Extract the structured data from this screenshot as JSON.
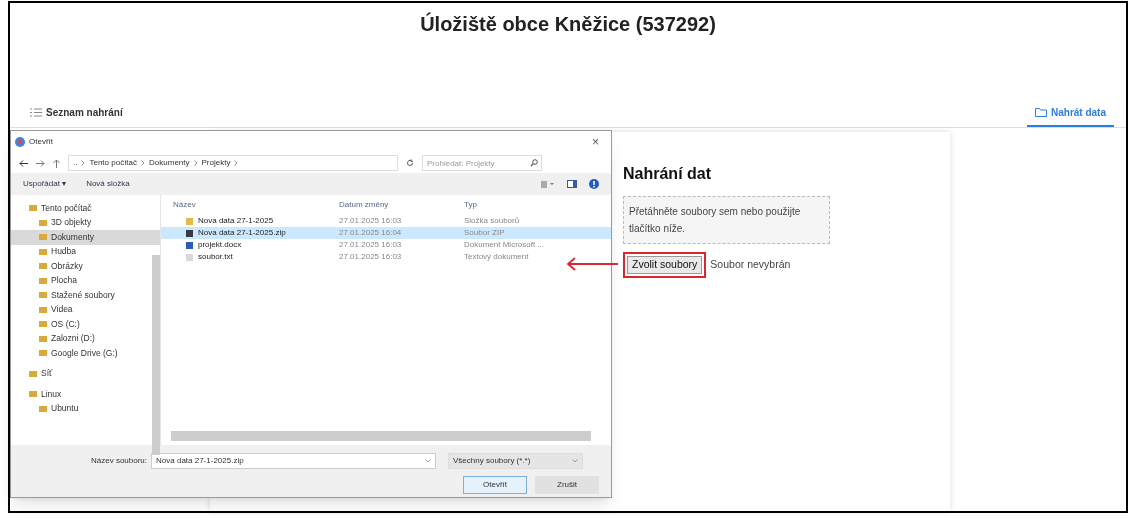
{
  "page": {
    "title": "Úložiště obce Kněžice (537292)"
  },
  "tabs": [
    {
      "label": "Seznam nahrání",
      "selected": false
    },
    {
      "label": "Nahrát data",
      "selected": true
    }
  ],
  "upload": {
    "heading": "Nahrání dat",
    "dropzone": "Přetáhněte soubory sem nebo použijte tlačítko níže.",
    "button": "Zvolit soubory",
    "status": "Soubor nevybrán",
    "button_highlighted": true
  },
  "dialog": {
    "title": "Otevřít",
    "close": "×",
    "path": [
      "..",
      "Tento počítač",
      "Dokumenty",
      "Projekty"
    ],
    "search_placeholder": "Prohledat: Projekty",
    "toolbar": [
      "Uspořádat ▾",
      "Nová složka"
    ],
    "tree": [
      {
        "label": "Tento počítač",
        "selected": false,
        "children": [
          {
            "label": "3D objekty",
            "selected": false
          },
          {
            "label": "Dokumenty",
            "selected": true
          },
          {
            "label": "Hudba",
            "selected": false
          },
          {
            "label": "Obrázky",
            "selected": false
          },
          {
            "label": "Plocha",
            "selected": false
          },
          {
            "label": "Stažené soubory",
            "selected": false
          },
          {
            "label": "Videa",
            "selected": false
          },
          {
            "label": "OS (C:)",
            "selected": false
          },
          {
            "label": "Zalozni (D:)",
            "selected": false
          },
          {
            "label": "Google Drive (G:)",
            "selected": false
          }
        ]
      },
      {
        "label": "Síť",
        "selected": false
      },
      {
        "label": "Linux",
        "selected": false,
        "children": [
          {
            "label": "Ubuntu",
            "selected": false
          }
        ]
      }
    ],
    "columns": [
      "Název",
      "Datum změny",
      "Typ"
    ],
    "files": [
      {
        "kind": "folder",
        "name": "Nova data 27-1-2025",
        "date": "27.01.2025 16:03",
        "type": "Složka souborů",
        "selected": false
      },
      {
        "kind": "zip",
        "name": "Nova data 27-1-2025.zip",
        "date": "27.01.2025 16:04",
        "type": "Soubor ZIP",
        "selected": true
      },
      {
        "kind": "docx",
        "name": "projekt.docx",
        "date": "27.01.2025 16:03",
        "type": "Dokument Microsoft ...",
        "selected": false
      },
      {
        "kind": "txt",
        "name": "soubor.txt",
        "date": "27.01.2025 16:03",
        "type": "Textový dokument",
        "selected": false
      }
    ],
    "filename_label": "Název souboru:",
    "filename": "Nova data 27-1-2025.zip",
    "filter": "Všechny soubory (*.*)",
    "buttons": [
      "Otevřít",
      "Zrušit"
    ]
  }
}
